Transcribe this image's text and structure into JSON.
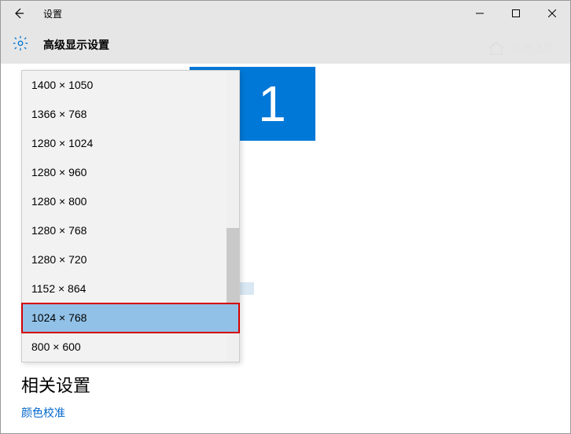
{
  "titlebar": {
    "title": "设置"
  },
  "header": {
    "title": "高级显示设置"
  },
  "monitor": {
    "number": "1"
  },
  "resolutions": {
    "items": [
      "1400 × 1050",
      "1366 × 768",
      "1280 × 1024",
      "1280 × 960",
      "1280 × 800",
      "1280 × 768",
      "1280 × 720",
      "1152 × 864",
      "1024 × 768",
      "800 × 600"
    ],
    "selected_index": 8
  },
  "section": {
    "title": "相关设置"
  },
  "links": {
    "color_calibration": "颜色校准"
  },
  "watermark": {
    "text": "系统之家"
  }
}
